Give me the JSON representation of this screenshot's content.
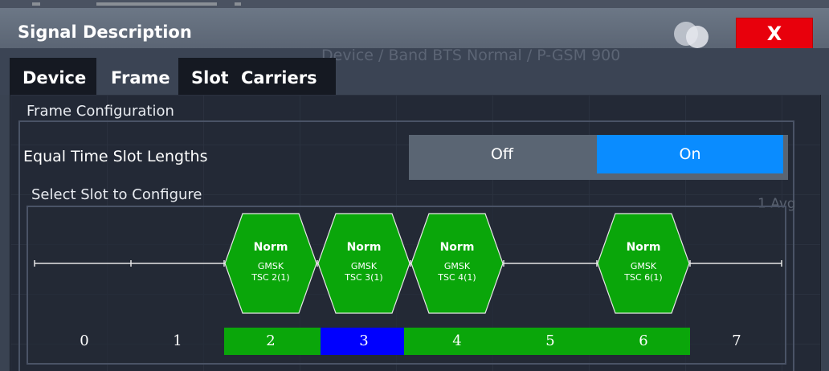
{
  "dialog": {
    "title": "Signal Description",
    "close_label": "X"
  },
  "tabs": [
    {
      "label": "Device",
      "active": false
    },
    {
      "label": "Frame",
      "active": true
    },
    {
      "label": "Slot",
      "active": false
    },
    {
      "label": "Carriers",
      "active": false
    }
  ],
  "background_text": {
    "device_band": "Device / Band BTS Normal / P-GSM 900",
    "avg": "1 Avg"
  },
  "frame": {
    "section_label": "Frame Configuration",
    "equal_slots_label": "Equal Time Slot Lengths",
    "toggle_off": "Off",
    "toggle_on": "On",
    "toggle_value": "On",
    "select_label": "Select Slot to Configure"
  },
  "slots": [
    {
      "number": "0",
      "active": false,
      "selected": false
    },
    {
      "number": "1",
      "active": false,
      "selected": false
    },
    {
      "number": "2",
      "active": true,
      "selected": false,
      "burst": "Norm",
      "modulation": "GMSK",
      "tsc": "TSC 2(1)"
    },
    {
      "number": "3",
      "active": true,
      "selected": true,
      "burst": "Norm",
      "modulation": "GMSK",
      "tsc": "TSC 3(1)"
    },
    {
      "number": "4",
      "active": true,
      "selected": false,
      "burst": "Norm",
      "modulation": "GMSK",
      "tsc": "TSC 4(1)"
    },
    {
      "number": "5",
      "active": true,
      "selected": false
    },
    {
      "number": "6",
      "active": true,
      "selected": false,
      "burst": "Norm",
      "modulation": "GMSK",
      "tsc": "TSC 6(1)"
    },
    {
      "number": "7",
      "active": false,
      "selected": false
    }
  ],
  "colors": {
    "active_slot": "#0aa60a",
    "selected_slot": "#0000ff",
    "inactive_slot": "#232936",
    "burst_fill": "#0aa60a",
    "burst_stroke": "#e6e6e6",
    "toggle_on": "#0a8cff",
    "close_button": "#e8000c"
  }
}
